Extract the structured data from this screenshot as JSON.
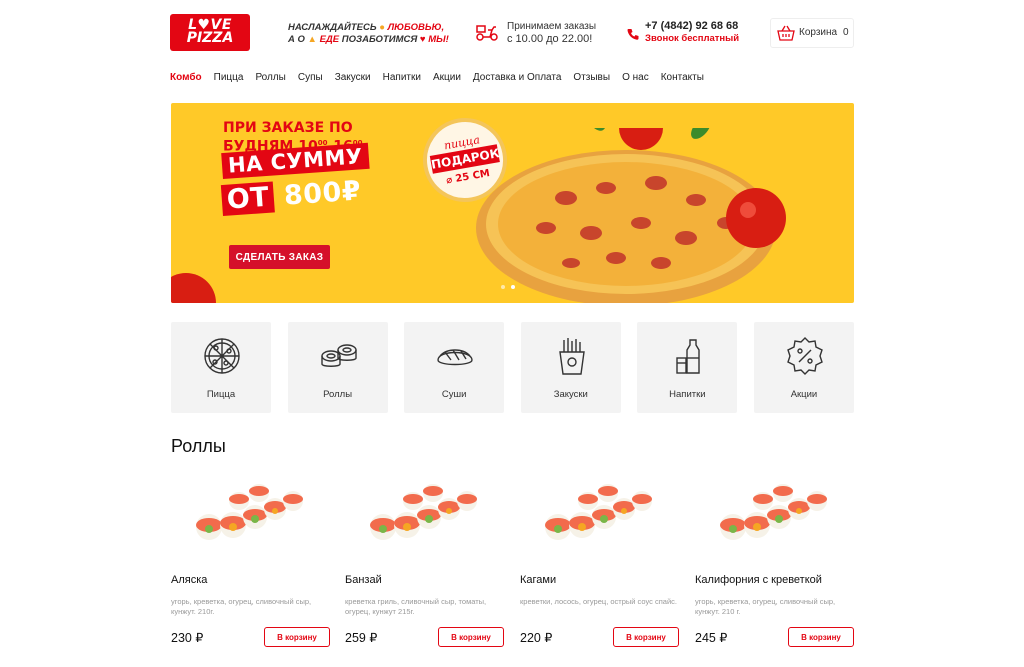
{
  "header": {
    "logo_line1": "L♥VE",
    "logo_line2": "PIZZA",
    "slogan_part1": "НАСЛАЖДАЙТЕСЬ",
    "slogan_part2": "ЛЮБОВЬЮ,",
    "slogan_part3": "А О",
    "slogan_part4": "ЕДЕ",
    "slogan_part5": "ПОЗАБОТИМСЯ",
    "slogan_part6": "МЫ!",
    "orders_line1": "Принимаем заказы",
    "orders_line2": "с 10.00 до 22.00!",
    "phone": "+7 (4842) 92 68 68",
    "phone_note": "Звонок бесплатный",
    "cart_label": "Корзина",
    "cart_count": "0"
  },
  "nav": [
    "Комбо",
    "Пицца",
    "Роллы",
    "Супы",
    "Закуски",
    "Напитки",
    "Акции",
    "Доставка и Оплата",
    "Отзывы",
    "О нас",
    "Контакты"
  ],
  "banner": {
    "line1": "ПРИ ЗАКАЗЕ ПО",
    "line2a": "БУДНЯМ 10",
    "line2b": "00",
    "line2c": "-16",
    "line2d": "00",
    "big1": "НА СУММУ",
    "big2a": "ОТ",
    "big2b": "800₽",
    "cta": "СДЕЛАТЬ ЗАКАЗ",
    "badge1": "пицца",
    "badge2": "ПОДАРОК",
    "badge3": "⌀ 25 СМ"
  },
  "categories": [
    {
      "label": "Пицца",
      "icon": "pizza-icon"
    },
    {
      "label": "Роллы",
      "icon": "rolls-icon"
    },
    {
      "label": "Суши",
      "icon": "sushi-icon"
    },
    {
      "label": "Закуски",
      "icon": "fries-icon"
    },
    {
      "label": "Напитки",
      "icon": "drinks-icon"
    },
    {
      "label": "Акции",
      "icon": "percent-badge-icon"
    }
  ],
  "section_title": "Роллы",
  "products": [
    {
      "name": "Аляска",
      "desc": "угорь, креветка, огурец, сливочный сыр, кунжут. 210г.",
      "price": "230 ₽",
      "button": "В корзину"
    },
    {
      "name": "Банзай",
      "desc": "креветка гриль, сливочный сыр, томаты, огурец, кунжут 215г.",
      "price": "259 ₽",
      "button": "В корзину"
    },
    {
      "name": "Кагами",
      "desc": "креветки, лосось, огурец, острый соус спайс.",
      "price": "220 ₽",
      "button": "В корзину"
    },
    {
      "name": "Калифорния с креветкой",
      "desc": "угорь, креветка, огурец, сливочный сыр, кунжут. 210 г.",
      "price": "245 ₽",
      "button": "В корзину"
    }
  ],
  "colors": {
    "accent": "#e30613",
    "banner_bg": "#ffc928",
    "tile_bg": "#f3f3f3"
  }
}
